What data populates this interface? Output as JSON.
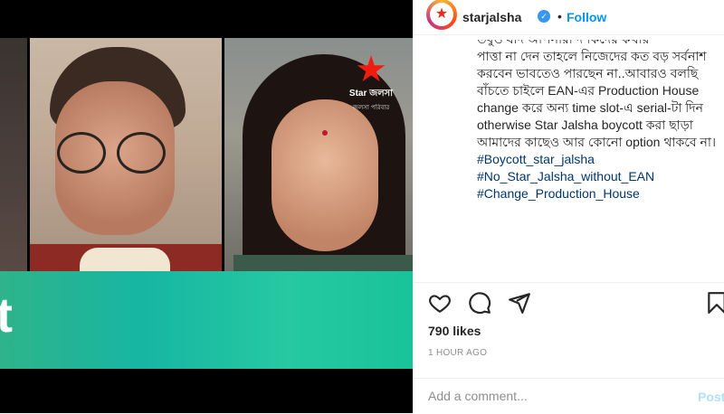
{
  "media": {
    "logo_text": "Star জলসা",
    "logo_sub": "জলসা পরিবার",
    "banner_letter": "t"
  },
  "header": {
    "username": "starjalsha",
    "verified": "✓",
    "separator": "•",
    "follow_label": "Follow"
  },
  "caption": {
    "top_line": "তবুও যদি আপনারা দর্শকদের কথার",
    "body": "পাত্তা না দেন তাহলে নিজেদের কত বড় সর্বনাশ করবেন ভাবতেও পারছেন না..আবারও বলছি বাঁচতে চাইলে EAN-এর Production House change করে অন্য time slot-এ serial-টা দিন otherwise Star Jalsha boycott করা ছাড়া আমাদের কাছেও আর কোনো option থাকবে না।",
    "hashtags": [
      "#Boycott_star_jalsha",
      "#No_Star_Jalsha_without_EAN",
      "#Change_Production_House"
    ]
  },
  "actions": {
    "icons": [
      "heart-icon",
      "comment-icon",
      "share-icon",
      "bookmark-icon"
    ]
  },
  "stats": {
    "likes": "790 likes",
    "time": "1 HOUR AGO"
  },
  "comment": {
    "placeholder": "Add a comment...",
    "post_label": "Post"
  },
  "colors": {
    "accent": "#0095f6",
    "hashtag": "#00376b",
    "banner": "#16b6a3",
    "logo_star": "#f01c10"
  }
}
